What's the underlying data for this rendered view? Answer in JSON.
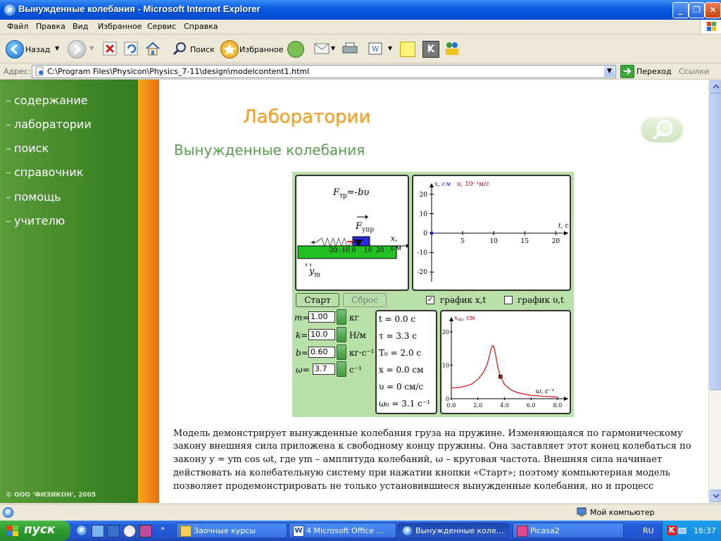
{
  "window": {
    "title": "Вынужденные колебания - Microsoft Internet Explorer"
  },
  "menu": [
    "Файл",
    "Правка",
    "Вид",
    "Избранное",
    "Сервис",
    "Справка"
  ],
  "toolbar": {
    "back": "Назад",
    "search": "Поиск",
    "favorites": "Избранное"
  },
  "address": {
    "label": "Адрес:",
    "url": "C:\\Program Files\\Physicon\\Physics_7-11\\design\\modelcontent1.html",
    "go": "Переход",
    "links": "Ссылки"
  },
  "sidebar": {
    "items": [
      "содержание",
      "лаборатории",
      "поиск",
      "справочник",
      "помощь",
      "учителю"
    ],
    "copyright": "© ООО 'ФИЗИКОН', 2005"
  },
  "page": {
    "heading": "Лаборатории",
    "subtitle": "Вынужденные колебания"
  },
  "applet": {
    "force_friction": "F",
    "force_friction_sub": "тр",
    "force_friction_expr": "=-bυ",
    "force_spring": "F",
    "force_spring_sub": "упр",
    "x_axis_label": "x, см",
    "scale_ticks": [
      "-20",
      "-10",
      "0",
      "10",
      "20"
    ],
    "ym_label": "y",
    "ym_sub": "m",
    "start_button": "Старт",
    "reset_button": "Сброс",
    "graph_xt_label": "график x,t",
    "graph_vt_label": "график υ,t",
    "graph_xt_checked": true,
    "graph_vt_checked": false,
    "params": [
      {
        "name": "m",
        "value": "1.00",
        "unit": "кг"
      },
      {
        "name": "k",
        "value": "10.0",
        "unit": "Н/м"
      },
      {
        "name": "b",
        "value": "0.60",
        "unit": "кг·с⁻¹"
      },
      {
        "name": "ω",
        "value": "3.7",
        "unit": "с⁻¹"
      }
    ],
    "readouts": [
      "t = 0.0 с",
      "τ = 3.3 с",
      "T₀ = 2.0 с",
      "x = 0.0 см",
      "υ = 0 см/с",
      "ω₀ = 3.1 с⁻¹"
    ],
    "plot1": {
      "ylabel_x": "x, см",
      "ylabel_v": "υ, 10⁻¹м/с",
      "xlabel": "t, с",
      "x_ticks": [
        "5",
        "10",
        "15",
        "20"
      ],
      "y_ticks": [
        "20",
        "10",
        "0",
        "-10",
        "-20"
      ]
    },
    "plot2": {
      "ylabel": "x",
      "ylabel_sub": "m",
      "ylabel_unit": ", см",
      "xlabel": "ω, с⁻¹",
      "x_ticks": [
        "0.0",
        "2.0",
        "4.0",
        "6.0",
        "8.0"
      ],
      "y_ticks": [
        "20",
        "10",
        "0"
      ]
    }
  },
  "description": [
    "Модель демонстрирует вынужденные колебания груза на пружине. Изменяющаяся по гармоническому",
    "закону внешняя сила приложена к свободному концу пружины. Она заставляет этот конец колебаться по",
    "закону y = ym cos ωt, где ym – амплитуда колебаний, ω – круговая частота. Внешняя сила начинает",
    "действовать на колебательную систему при нажатии кнопки «Старт»; поэтому компьютерная модель",
    "позволяет продемонстрировать не только установившиеся вынужденные колебания, но и процесс"
  ],
  "status": {
    "zone": "Мой компьютер"
  },
  "taskbar": {
    "start": "пуск",
    "tasks": [
      "Заочные курсы",
      "4 Microsoft Office ...",
      "Вынужденные коле...",
      "Picasa2"
    ],
    "lang": "RU",
    "clock": "16:37"
  },
  "chart_data": [
    {
      "type": "line",
      "x_label": "t, с",
      "y_label": "x, см",
      "xlim": [
        0,
        22
      ],
      "ylim": [
        -25,
        25
      ],
      "x": [
        0
      ],
      "series": [
        {
          "name": "x, см",
          "values": [
            0
          ]
        }
      ]
    },
    {
      "type": "line",
      "x_label": "ω, с⁻¹",
      "y_label": "xm, см",
      "xlim": [
        0,
        8.8
      ],
      "ylim": [
        0,
        24
      ],
      "series": [
        {
          "name": "xm, см",
          "x": [
            0,
            0.5,
            1.0,
            1.5,
            2.0,
            2.4,
            2.7,
            2.9,
            3.0,
            3.1,
            3.2,
            3.3,
            3.5,
            3.7,
            4.0,
            4.5,
            5.0,
            6.0,
            7.0,
            8.0
          ],
          "y": [
            3.2,
            3.3,
            3.7,
            4.3,
            5.8,
            7.7,
            10.3,
            13.3,
            15.0,
            15.9,
            15.6,
            13.7,
            9.5,
            6.6,
            4.3,
            2.6,
            1.8,
            1.0,
            0.7,
            0.5
          ]
        }
      ],
      "current_point": {
        "x": 3.7,
        "y": 6.6
      }
    }
  ]
}
